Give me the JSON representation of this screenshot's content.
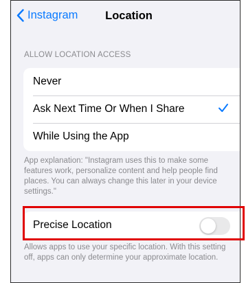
{
  "nav": {
    "back_label": "Instagram",
    "title": "Location"
  },
  "location_access": {
    "header": "ALLOW LOCATION ACCESS",
    "options": [
      {
        "label": "Never",
        "selected": false
      },
      {
        "label": "Ask Next Time Or When I Share",
        "selected": true
      },
      {
        "label": "While Using the App",
        "selected": false
      }
    ],
    "explanation": "App explanation: \"Instagram uses this to make some features work, personalize content and help people find places. You can always change this later in your device settings.\""
  },
  "precise_location": {
    "label": "Precise Location",
    "enabled": false,
    "footnote": "Allows apps to use your specific location. With this setting off, apps can only determine your approximate location."
  },
  "colors": {
    "accent": "#0a7aff",
    "background": "#f2f2f7",
    "highlight": "#e00000",
    "toggle_off": "#e9e9ea"
  }
}
